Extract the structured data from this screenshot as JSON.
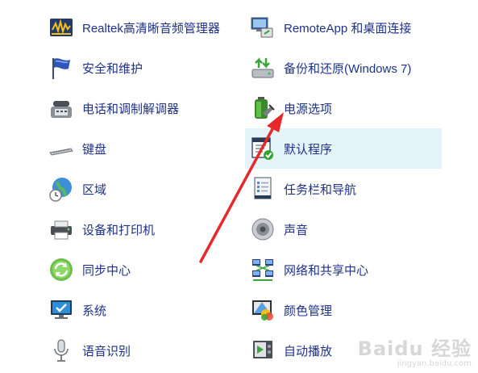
{
  "left_items": [
    {
      "label": "Realtek高清晰音频管理器",
      "icon": "realtek-audio-icon"
    },
    {
      "label": "安全和维护",
      "icon": "security-flag-icon"
    },
    {
      "label": "电话和调制解调器",
      "icon": "phone-modem-icon"
    },
    {
      "label": "键盘",
      "icon": "keyboard-icon"
    },
    {
      "label": "区域",
      "icon": "globe-clock-icon"
    },
    {
      "label": "设备和打印机",
      "icon": "printer-icon"
    },
    {
      "label": "同步中心",
      "icon": "sync-icon"
    },
    {
      "label": "系统",
      "icon": "monitor-check-icon"
    },
    {
      "label": "语音识别",
      "icon": "microphone-icon"
    }
  ],
  "right_items": [
    {
      "label": "RemoteApp 和桌面连接",
      "icon": "remoteapp-icon"
    },
    {
      "label": "备份和还原(Windows 7)",
      "icon": "backup-restore-icon"
    },
    {
      "label": "电源选项",
      "icon": "power-battery-icon"
    },
    {
      "label": "默认程序",
      "icon": "default-programs-icon",
      "hovered": true
    },
    {
      "label": "任务栏和导航",
      "icon": "taskbar-icon"
    },
    {
      "label": "声音",
      "icon": "speaker-icon"
    },
    {
      "label": "网络和共享中心",
      "icon": "network-icon"
    },
    {
      "label": "颜色管理",
      "icon": "color-management-icon"
    },
    {
      "label": "自动播放",
      "icon": "autoplay-icon"
    }
  ],
  "watermark": {
    "line1": "Baidu 经验",
    "line2": "jingyan.baidu.com"
  },
  "colors": {
    "link": "#1e3287",
    "hover_bg": "#e5f3fb",
    "arrow": "#e8292b"
  }
}
